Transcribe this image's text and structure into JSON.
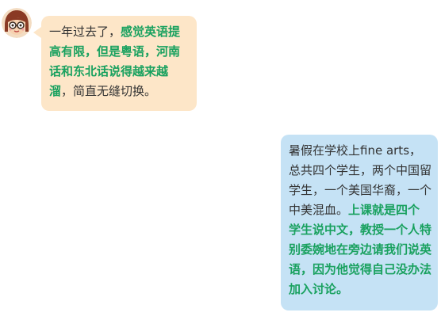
{
  "messages": {
    "left": {
      "plain_1": "一年过去了，",
      "green_1": "感觉英语提高有限，但是粤语，河南话和东北话说得越来越溜",
      "plain_2": "，简直无缝切换。"
    },
    "right": {
      "plain_1": "暑假在学校上fine arts，总共四个学生，两个中国留学生，一个美国华裔，一个中美混血。",
      "green_1": "上课就是四个学生说中文，教授一个人特别委婉地在旁边请我们说英语，因为他觉得自己没办法加入讨论。"
    }
  },
  "avatar": {
    "icon": "girl-with-glasses-avatar",
    "colors": {
      "bubble_left_bg": "#fde6c8",
      "bubble_right_bg": "#c5e2f5",
      "highlight_green": "#19a15f"
    }
  }
}
